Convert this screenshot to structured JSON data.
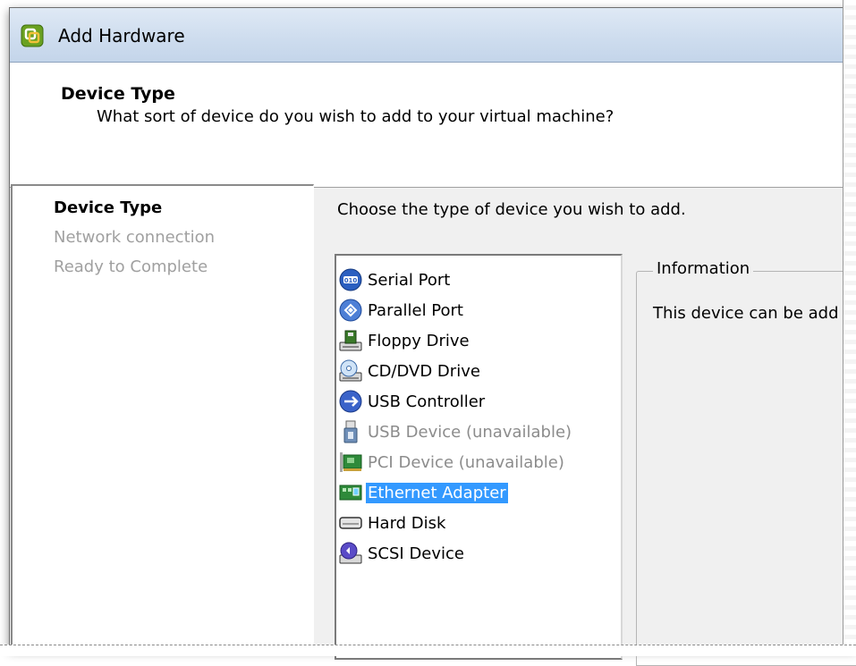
{
  "window": {
    "title": "Add Hardware",
    "icon": "vsphere-logo-icon"
  },
  "header": {
    "title": "Device Type",
    "subtitle": "What sort of device do you wish to add to your virtual machine?"
  },
  "nav": {
    "items": [
      {
        "label": "Device Type",
        "state": "active"
      },
      {
        "label": "Network connection",
        "state": "inactive"
      },
      {
        "label": "Ready to Complete",
        "state": "inactive"
      }
    ]
  },
  "main": {
    "prompt": "Choose the type of device you wish to add.",
    "devices": [
      {
        "label": "Serial Port",
        "icon": "serial-port-icon",
        "state": "normal"
      },
      {
        "label": "Parallel Port",
        "icon": "parallel-port-icon",
        "state": "normal"
      },
      {
        "label": "Floppy Drive",
        "icon": "floppy-drive-icon",
        "state": "normal"
      },
      {
        "label": "CD/DVD Drive",
        "icon": "cd-dvd-drive-icon",
        "state": "normal"
      },
      {
        "label": "USB Controller",
        "icon": "usb-controller-icon",
        "state": "normal"
      },
      {
        "label": "USB Device (unavailable)",
        "icon": "usb-device-icon",
        "state": "disabled"
      },
      {
        "label": "PCI Device (unavailable)",
        "icon": "pci-device-icon",
        "state": "disabled"
      },
      {
        "label": "Ethernet Adapter",
        "icon": "ethernet-adapter-icon",
        "state": "selected"
      },
      {
        "label": "Hard Disk",
        "icon": "hard-disk-icon",
        "state": "normal"
      },
      {
        "label": "SCSI Device",
        "icon": "scsi-device-icon",
        "state": "normal"
      }
    ]
  },
  "info": {
    "legend": "Information",
    "text": "This device can be add"
  },
  "colors": {
    "selection": "#3399ff",
    "disabled_text": "#8c8c8c",
    "titlebar": "#cddcee"
  }
}
